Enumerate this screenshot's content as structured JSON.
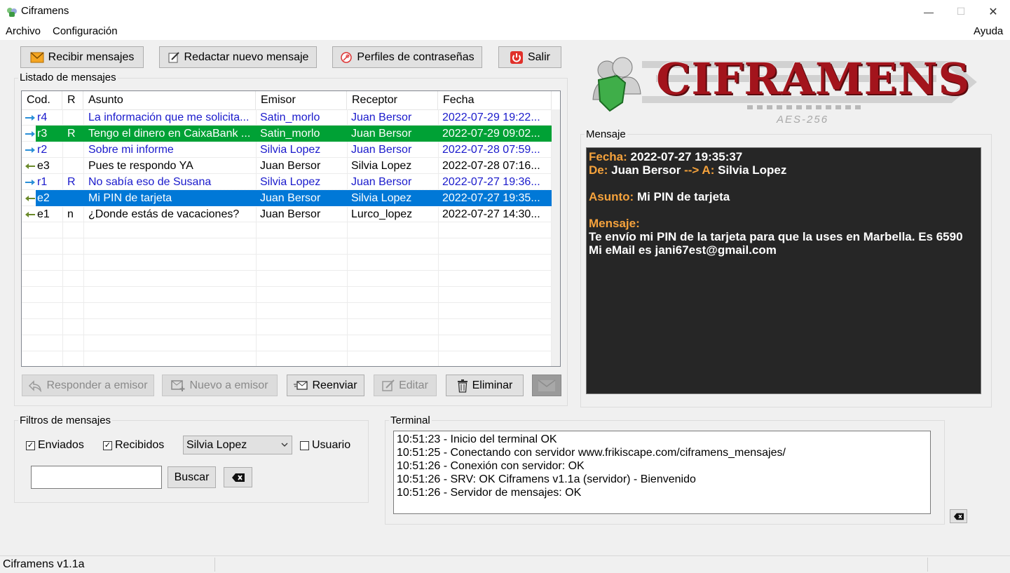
{
  "window": {
    "title": "Ciframens",
    "minimize": "—",
    "maximize": "☐",
    "close": "✕"
  },
  "menu": {
    "archivo": "Archivo",
    "configuracion": "Configuración",
    "ayuda": "Ayuda"
  },
  "toolbar": {
    "recibir": "Recibir mensajes",
    "redactar": "Redactar nuevo mensaje",
    "perfiles": "Perfiles de contraseñas",
    "salir": "Salir"
  },
  "logo": {
    "name": "CIFRAMENS",
    "sub": "AES-256"
  },
  "list": {
    "group_title": "Listado de mensajes",
    "headers": [
      "Cod.",
      "R",
      "Asunto",
      "Emisor",
      "Receptor",
      "Fecha"
    ],
    "rows": [
      {
        "cod": "r4",
        "r": "",
        "asunto": "La información que me solicita...",
        "emisor": "Satin_morlo",
        "receptor": "Juan Bersor",
        "fecha": "2022-07-29 19:22...",
        "kind": "in",
        "style": "blue"
      },
      {
        "cod": "r3",
        "r": "R",
        "asunto": "Tengo el dinero en CaixaBank ...",
        "emisor": "Satin_morlo",
        "receptor": "Juan Bersor",
        "fecha": "2022-07-29 09:02...",
        "kind": "in",
        "style": "green"
      },
      {
        "cod": "r2",
        "r": "",
        "asunto": "Sobre mi informe",
        "emisor": "Silvia Lopez",
        "receptor": "Juan Bersor",
        "fecha": "2022-07-28 07:59...",
        "kind": "in",
        "style": "blue"
      },
      {
        "cod": "e3",
        "r": "",
        "asunto": "Pues te respondo YA",
        "emisor": "Juan Bersor",
        "receptor": "Silvia Lopez",
        "fecha": "2022-07-28 07:16...",
        "kind": "out",
        "style": "normal"
      },
      {
        "cod": "r1",
        "r": "R",
        "asunto": "No sabía eso de Susana",
        "emisor": "Silvia Lopez",
        "receptor": "Juan Bersor",
        "fecha": "2022-07-27 19:36...",
        "kind": "in",
        "style": "blue"
      },
      {
        "cod": "e2",
        "r": "",
        "asunto": "Mi PIN de tarjeta",
        "emisor": "Juan Bersor",
        "receptor": "Silvia Lopez",
        "fecha": "2022-07-27 19:35...",
        "kind": "out",
        "style": "selected"
      },
      {
        "cod": "e1",
        "r": "n",
        "asunto": "¿Donde estás de vacaciones?",
        "emisor": "Juan Bersor",
        "receptor": "Lurco_lopez",
        "fecha": "2022-07-27 14:30...",
        "kind": "out",
        "style": "normal"
      }
    ]
  },
  "actions": {
    "responder": "Responder a emisor",
    "nuevo": "Nuevo a emisor",
    "reenviar": "Reenviar",
    "editar": "Editar",
    "eliminar": "Eliminar"
  },
  "message": {
    "group_title": "Mensaje",
    "fecha_label": "Fecha:",
    "fecha_value": "2022-07-27 19:35:37",
    "de_label": "De:",
    "de_value": "Juan Bersor",
    "arrow": "-->",
    "a_label": "A:",
    "a_value": "Silvia Lopez",
    "asunto_label": "Asunto:",
    "asunto_value": "Mi PIN de tarjeta",
    "mensaje_label": "Mensaje:",
    "body_line1": "Te envío mi PIN de la tarjeta para que la uses en Marbella. Es 6590",
    "body_line2": "Mi eMail es jani67est@gmail.com"
  },
  "filters": {
    "group_title": "Filtros de mensajes",
    "enviados": "Enviados",
    "recibidos": "Recibidos",
    "usuario_select": "Silvia Lopez",
    "usuario": "Usuario",
    "search_value": "",
    "buscar": "Buscar"
  },
  "terminal": {
    "group_title": "Terminal",
    "lines": [
      "10:51:23 - Inicio del terminal OK",
      "10:51:25 - Conectando con servidor www.frikiscape.com/ciframens_mensajes/",
      "10:51:26 - Conexión con servidor: OK",
      "10:51:26 - SRV: OK Ciframens v1.1a (servidor) - Bienvenido",
      "10:51:26 - Servidor de mensajes: OK"
    ]
  },
  "status": {
    "text": "Ciframens v1.1a"
  },
  "colors": {
    "blue_text": "#1a1acc",
    "green_row": "#00a135",
    "selected_row": "#0078d7",
    "accent_orange": "#f5a23c",
    "logo_red": "#a3141c"
  }
}
